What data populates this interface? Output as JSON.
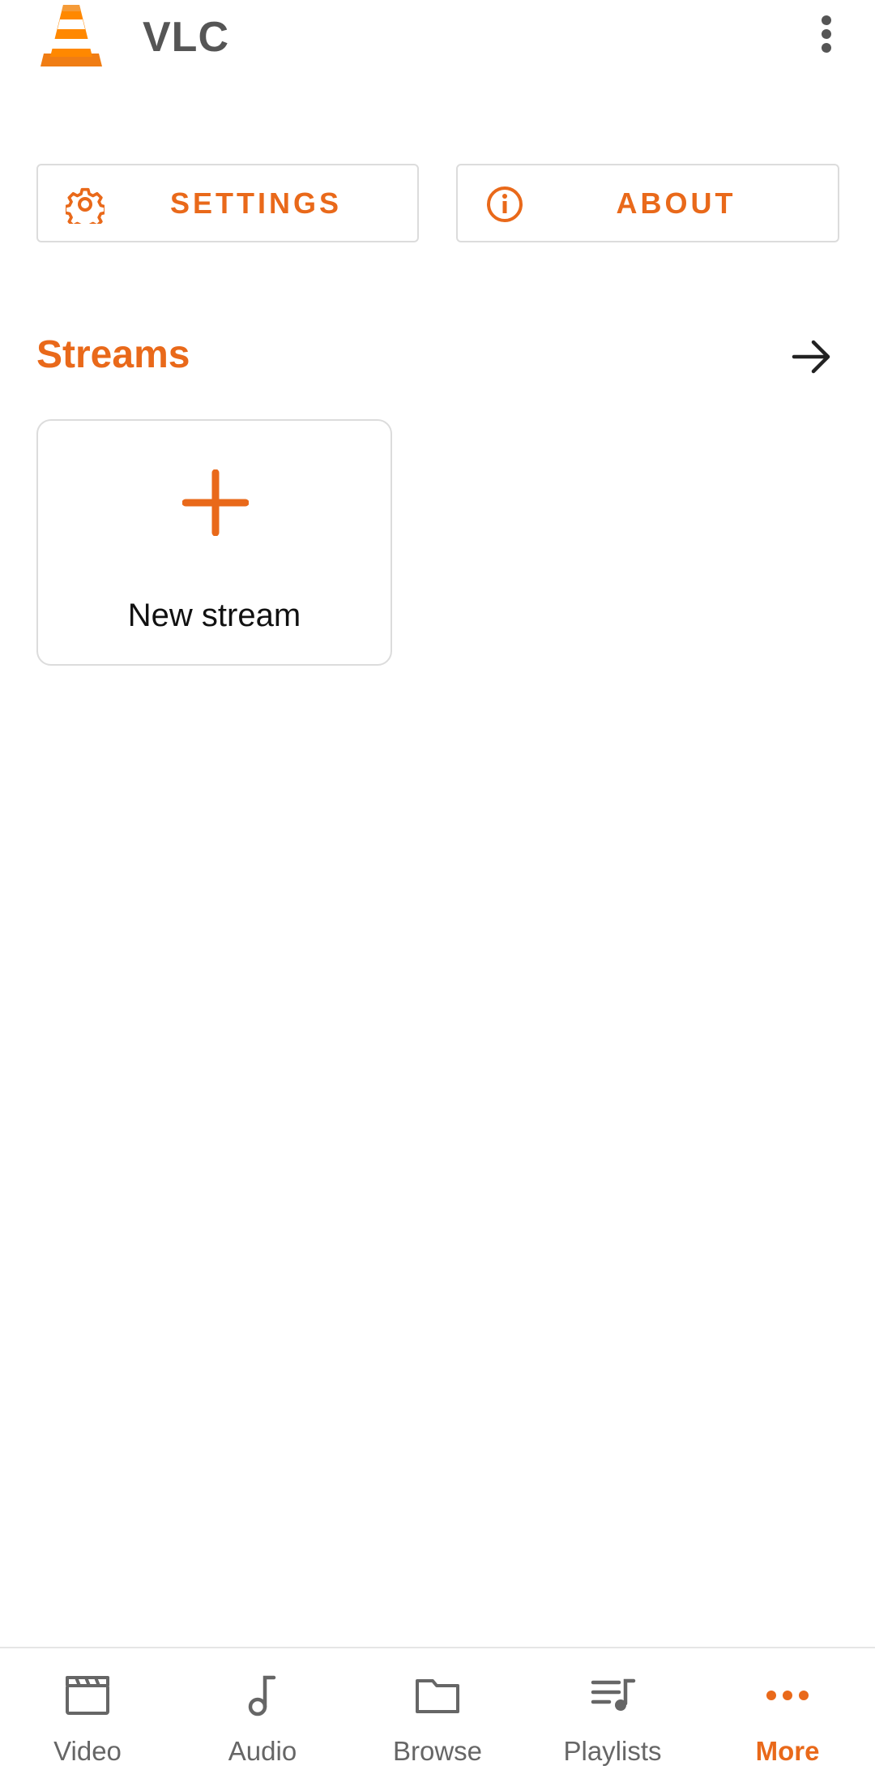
{
  "app": {
    "title": "VLC"
  },
  "actions": {
    "settings_label": "SETTINGS",
    "about_label": "ABOUT"
  },
  "streams": {
    "section_title": "Streams",
    "new_stream_label": "New stream"
  },
  "bottom_nav": {
    "items": [
      {
        "label": "Video",
        "icon": "video-icon"
      },
      {
        "label": "Audio",
        "icon": "audio-icon"
      },
      {
        "label": "Browse",
        "icon": "folder-icon"
      },
      {
        "label": "Playlists",
        "icon": "playlists-icon"
      },
      {
        "label": "More",
        "icon": "more-icon",
        "active": true
      }
    ]
  },
  "colors": {
    "accent": "#e9691a",
    "text_muted": "#666666",
    "border": "#dcdcdc"
  }
}
